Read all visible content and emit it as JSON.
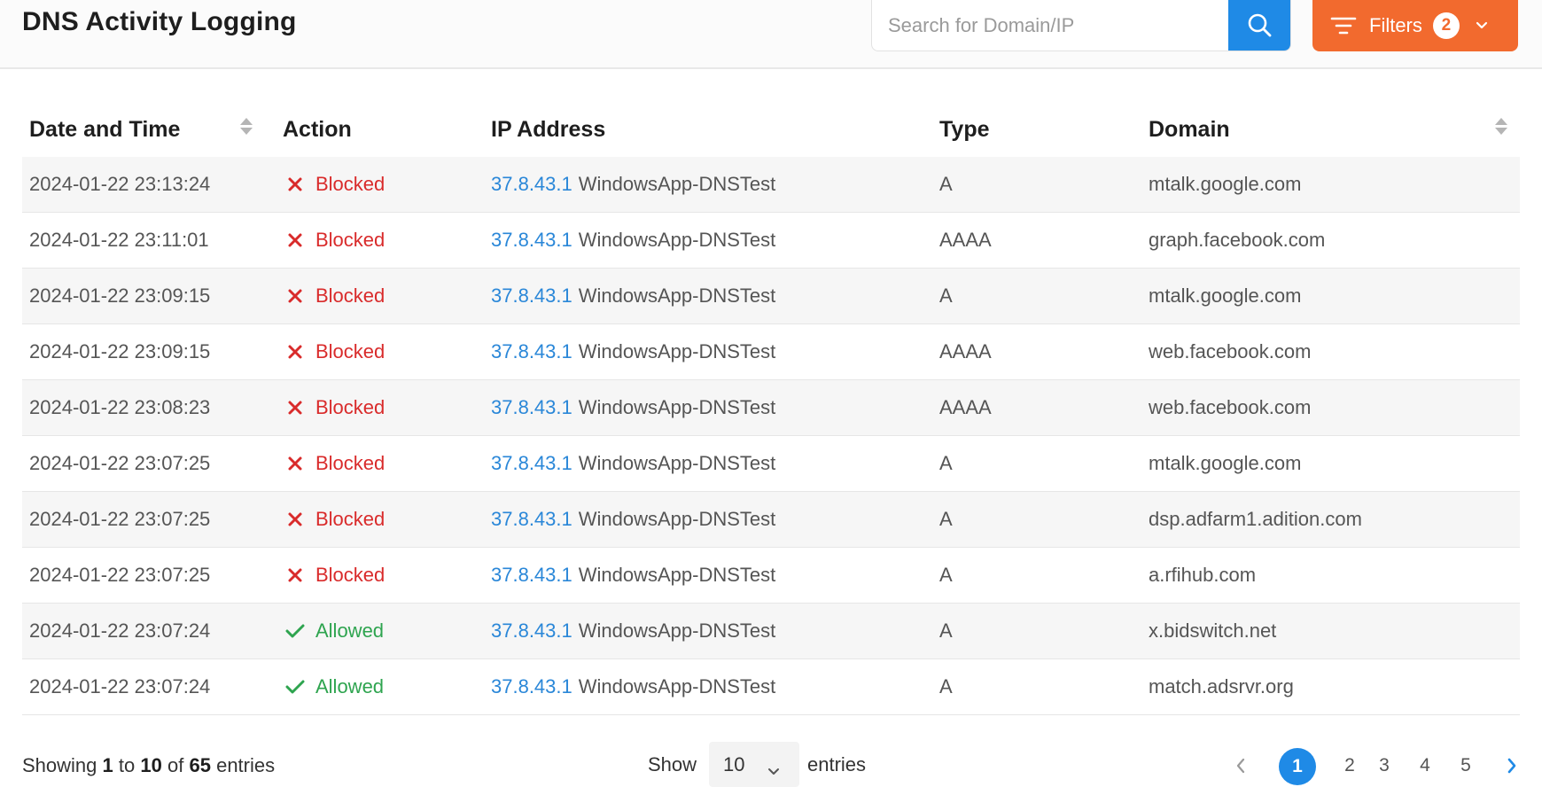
{
  "header": {
    "title": "DNS Activity Logging",
    "search_placeholder": "Search for Domain/IP",
    "search_value": "",
    "filters_label": "Filters",
    "filters_count": "2"
  },
  "colors": {
    "accent": "#1f8ae6",
    "filters": "#f26a2e",
    "blocked": "#d92b2b",
    "allowed": "#2ea44f",
    "ip_link": "#2a87d8"
  },
  "table": {
    "columns": [
      "Date and Time",
      "Action",
      "IP Address",
      "Type",
      "Domain"
    ],
    "rows": [
      {
        "datetime": "2024-01-22 23:13:24",
        "action": "Blocked",
        "ip": "37.8.43.1",
        "host": "WindowsApp-DNSTest",
        "type": "A",
        "domain": "mtalk.google.com"
      },
      {
        "datetime": "2024-01-22 23:11:01",
        "action": "Blocked",
        "ip": "37.8.43.1",
        "host": "WindowsApp-DNSTest",
        "type": "AAAA",
        "domain": "graph.facebook.com"
      },
      {
        "datetime": "2024-01-22 23:09:15",
        "action": "Blocked",
        "ip": "37.8.43.1",
        "host": "WindowsApp-DNSTest",
        "type": "A",
        "domain": "mtalk.google.com"
      },
      {
        "datetime": "2024-01-22 23:09:15",
        "action": "Blocked",
        "ip": "37.8.43.1",
        "host": "WindowsApp-DNSTest",
        "type": "AAAA",
        "domain": "web.facebook.com"
      },
      {
        "datetime": "2024-01-22 23:08:23",
        "action": "Blocked",
        "ip": "37.8.43.1",
        "host": "WindowsApp-DNSTest",
        "type": "AAAA",
        "domain": "web.facebook.com"
      },
      {
        "datetime": "2024-01-22 23:07:25",
        "action": "Blocked",
        "ip": "37.8.43.1",
        "host": "WindowsApp-DNSTest",
        "type": "A",
        "domain": "mtalk.google.com"
      },
      {
        "datetime": "2024-01-22 23:07:25",
        "action": "Blocked",
        "ip": "37.8.43.1",
        "host": "WindowsApp-DNSTest",
        "type": "A",
        "domain": "dsp.adfarm1.adition.com"
      },
      {
        "datetime": "2024-01-22 23:07:25",
        "action": "Blocked",
        "ip": "37.8.43.1",
        "host": "WindowsApp-DNSTest",
        "type": "A",
        "domain": "a.rfihub.com"
      },
      {
        "datetime": "2024-01-22 23:07:24",
        "action": "Allowed",
        "ip": "37.8.43.1",
        "host": "WindowsApp-DNSTest",
        "type": "A",
        "domain": "x.bidswitch.net"
      },
      {
        "datetime": "2024-01-22 23:07:24",
        "action": "Allowed",
        "ip": "37.8.43.1",
        "host": "WindowsApp-DNSTest",
        "type": "A",
        "domain": "match.adsrvr.org"
      }
    ]
  },
  "footer": {
    "showing_prefix": "Showing",
    "showing_from": "1",
    "showing_to_word": "to",
    "showing_to": "10",
    "showing_of_word": "of",
    "showing_total": "65",
    "showing_suffix": "entries",
    "show_label": "Show",
    "page_size": "10",
    "entries_label": "entries",
    "pages": [
      "1",
      "2",
      "3",
      "4",
      "5"
    ],
    "current_page": "1"
  }
}
